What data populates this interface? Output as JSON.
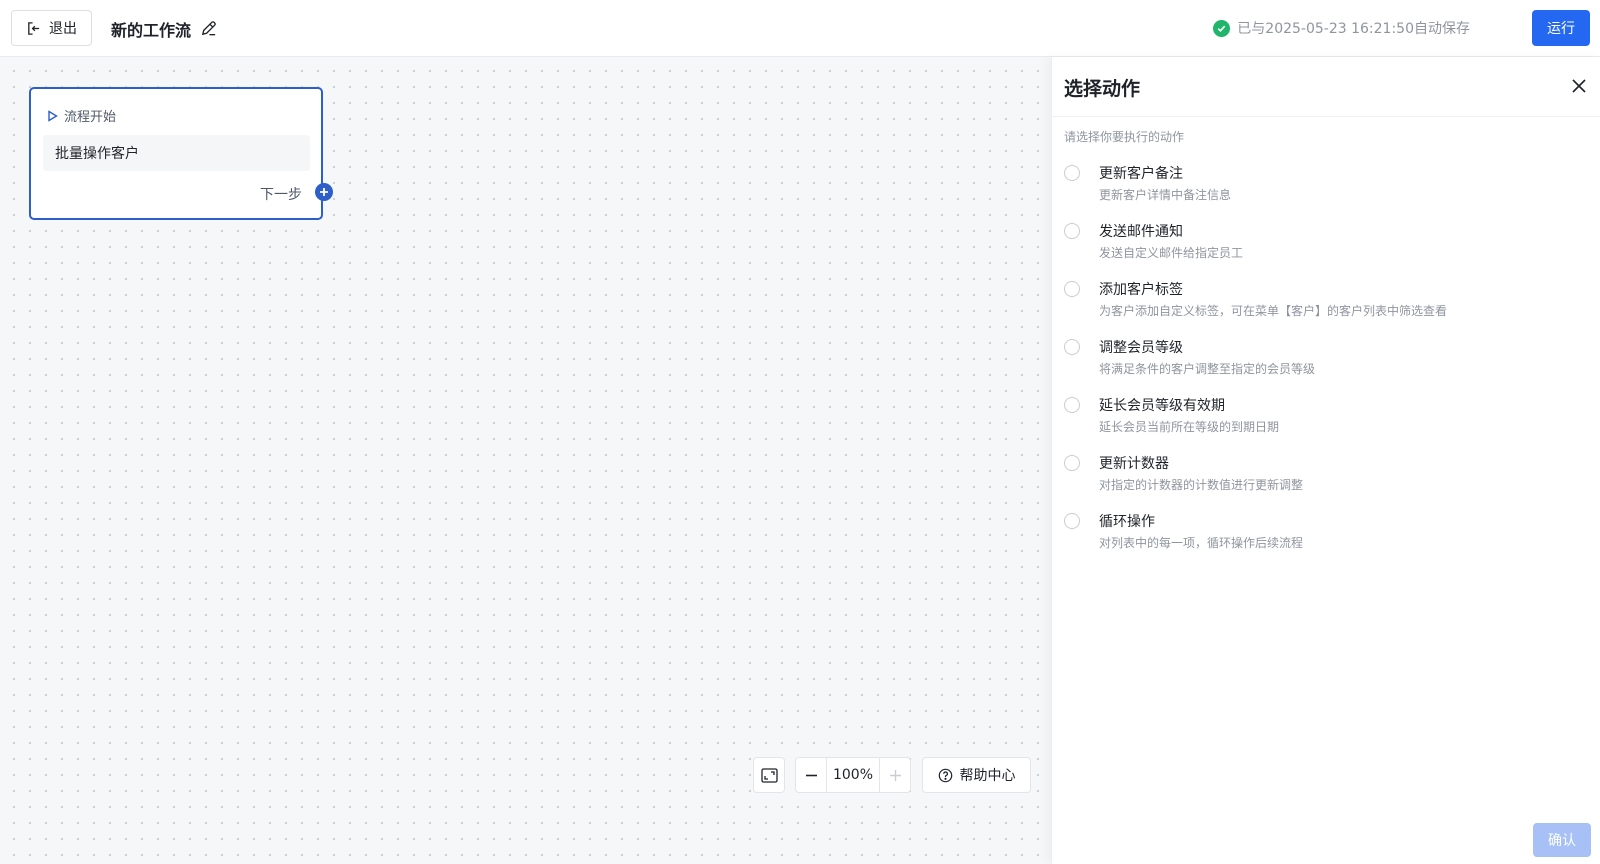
{
  "header": {
    "exit_label": "退出",
    "workflow_title": "新的工作流",
    "save_status": "已与2025-05-23 16:21:50自动保存",
    "run_label": "运行"
  },
  "canvas": {
    "node": {
      "head_label": "流程开始",
      "body_label": "批量操作客户",
      "next_label": "下一步"
    },
    "zoom": "100%",
    "help_label": "帮助中心"
  },
  "panel": {
    "title": "选择动作",
    "subtitle": "请选择你要执行的动作",
    "options": [
      {
        "title": "更新客户备注",
        "desc": "更新客户详情中备注信息"
      },
      {
        "title": "发送邮件通知",
        "desc": "发送自定义邮件给指定员工"
      },
      {
        "title": "添加客户标签",
        "desc": "为客户添加自定义标签，可在菜单【客户】的客户列表中筛选查看"
      },
      {
        "title": "调整会员等级",
        "desc": "将满足条件的客户调整至指定的会员等级"
      },
      {
        "title": "延长会员等级有效期",
        "desc": "延长会员当前所在等级的到期日期"
      },
      {
        "title": "更新计数器",
        "desc": "对指定的计数器的计数值进行更新调整"
      },
      {
        "title": "循环操作",
        "desc": "对列表中的每一项，循环操作后续流程"
      }
    ],
    "confirm_label": "确认"
  },
  "colors": {
    "primary": "#2468f2",
    "primary_disabled": "#a7c0f6",
    "node_border": "#2e5ec9",
    "success": "#21b56b"
  }
}
